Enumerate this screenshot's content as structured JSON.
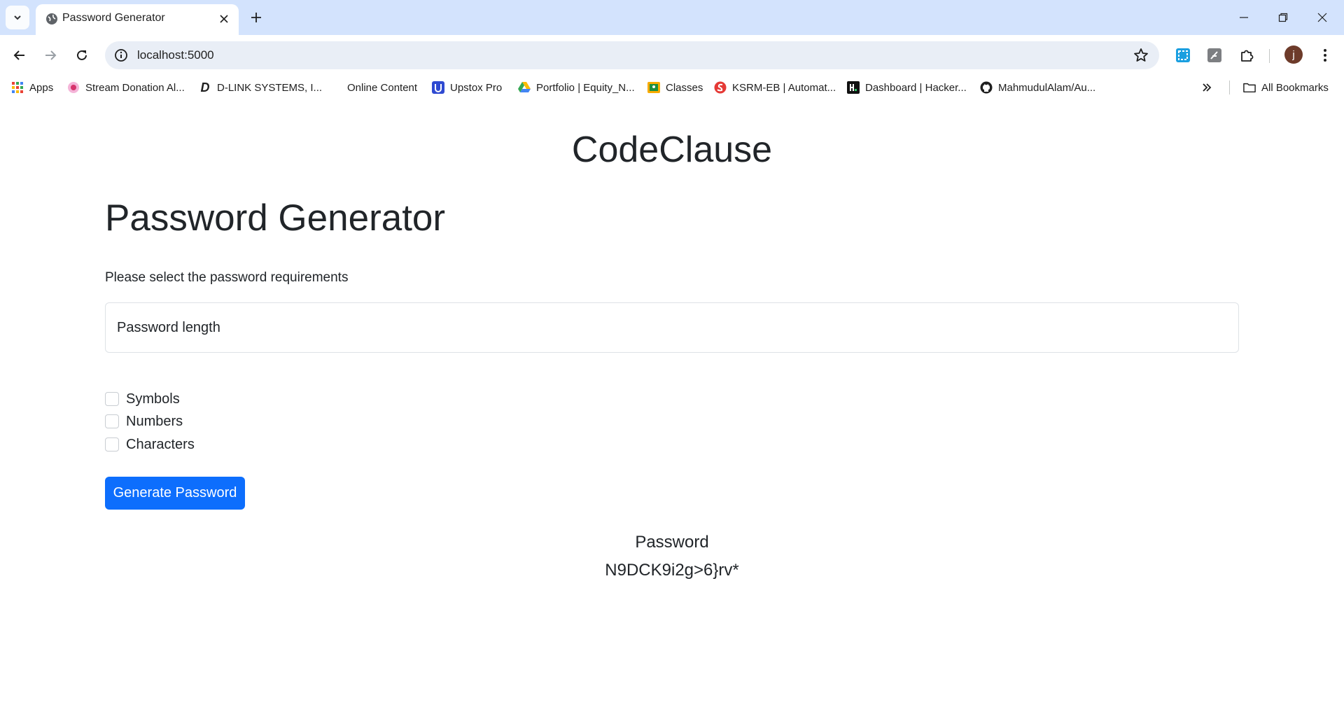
{
  "browser": {
    "tab_title": "Password Generator",
    "url": "localhost:5000",
    "avatar_initial": "j",
    "bookmarks": [
      {
        "label": "Apps",
        "icon": "apps-grid-icon"
      },
      {
        "label": "Stream Donation Al...",
        "icon": "stream-donation-icon"
      },
      {
        "label": "D-LINK SYSTEMS, I...",
        "icon": "dlink-icon"
      },
      {
        "label": "Online Content",
        "icon": ""
      },
      {
        "label": "Upstox Pro",
        "icon": "upstox-icon"
      },
      {
        "label": "Portfolio | Equity_N...",
        "icon": "drive-icon"
      },
      {
        "label": "Classes",
        "icon": "classroom-icon"
      },
      {
        "label": "KSRM-EB | Automat...",
        "icon": "ksrm-icon"
      },
      {
        "label": "Dashboard | Hacker...",
        "icon": "hackerrank-icon"
      },
      {
        "label": "MahmudulAlam/Au...",
        "icon": "github-icon"
      }
    ],
    "all_bookmarks_label": "All Bookmarks"
  },
  "page": {
    "brand": "CodeClause",
    "title": "Password Generator",
    "lead": "Please select the password requirements",
    "length_placeholder": "Password length",
    "options": [
      "Symbols",
      "Numbers",
      "Characters"
    ],
    "button_label": "Generate Password",
    "result_label": "Password",
    "result_value": "N9DCK9i2g>6}rv*"
  },
  "colors": {
    "primary": "#0d6efd",
    "tabstrip": "#d3e3fd",
    "omnibox": "#e9eef6"
  }
}
